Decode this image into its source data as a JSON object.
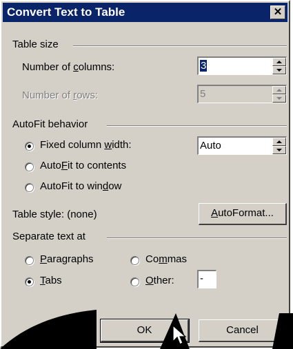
{
  "window": {
    "title": "Convert Text to Table",
    "close_glyph": "✕"
  },
  "table_size": {
    "group_label": "Table size",
    "columns_label_pre": "Number of ",
    "columns_label_u": "c",
    "columns_label_post": "olumns:",
    "columns_value": "3",
    "rows_label_pre": "Number of ",
    "rows_label_u": "r",
    "rows_label_post": "ows:",
    "rows_value": "5"
  },
  "autofit": {
    "group_label": "AutoFit behavior",
    "fixed_pre": "Fixed column ",
    "fixed_u": "w",
    "fixed_post": "idth:",
    "fixed_value": "Auto",
    "contents_pre": "Auto",
    "contents_u": "F",
    "contents_post": "it to contents",
    "window_pre": "AutoFit to win",
    "window_u": "d",
    "window_post": "ow"
  },
  "table_style": {
    "label": "Table style: (none)",
    "autoformat_u": "A",
    "autoformat_post": "utoFormat..."
  },
  "separate": {
    "group_label": "Separate text at",
    "paragraphs_u": "P",
    "paragraphs_post": "aragraphs",
    "commas_pre": "Co",
    "commas_u": "m",
    "commas_post": "mas",
    "tabs_u": "T",
    "tabs_post": "abs",
    "other_u": "O",
    "other_post": "ther:",
    "other_value": "-"
  },
  "buttons": {
    "ok": "OK",
    "cancel": "Cancel"
  },
  "colors": {
    "titlebar": "#0a246a",
    "face": "#d4d0c8",
    "watermark": "#000000"
  }
}
